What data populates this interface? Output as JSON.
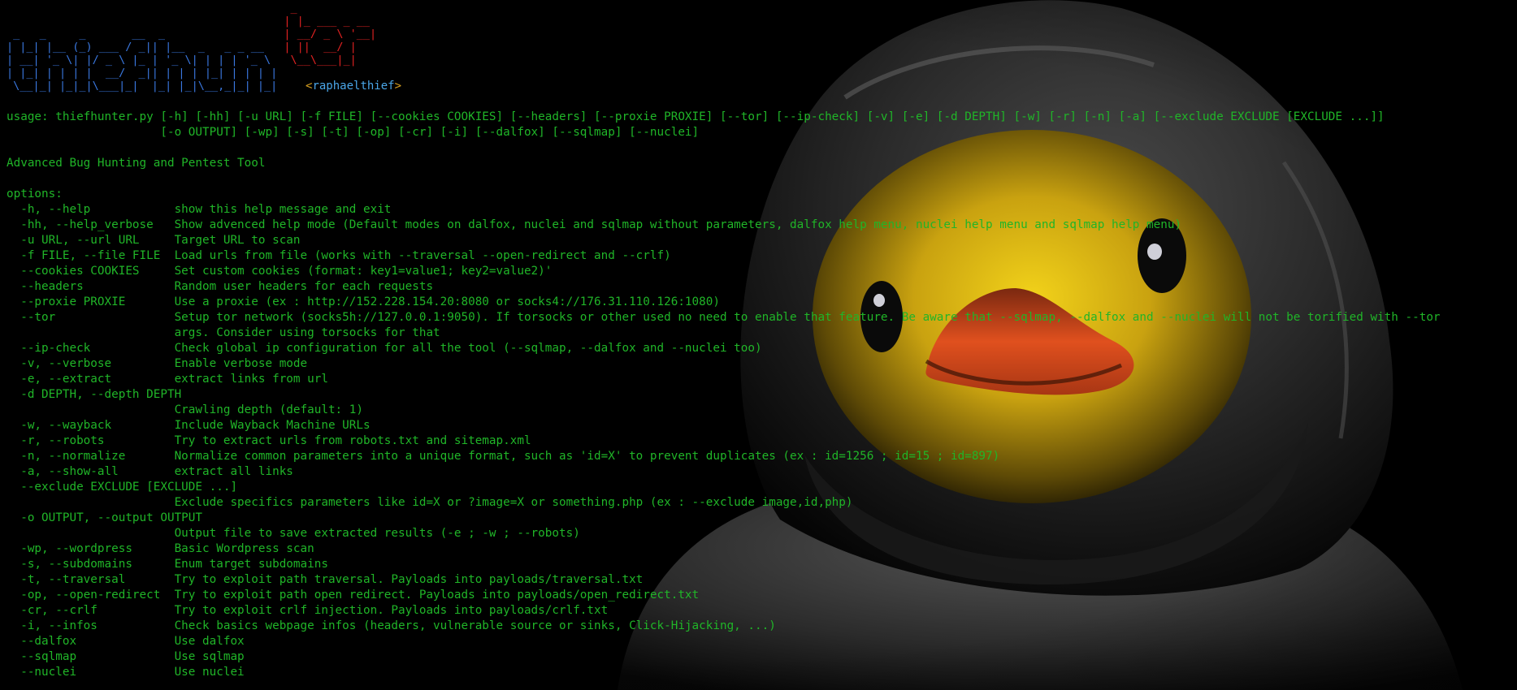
{
  "banner": {
    "ascii_blue": " _   _     _       __  _\n| |_| |__ (_) ___ / _|| |__  _   _ _ __\n| __| '_ \\| |/ _ \\ |_ | '_ \\| | | | '_ \\\n| |_| | | | |  __/  _|| | | | |_| | | | |\n \\__|_| |_|_|\\___|_|  |_| |_|\\__,_|_| |_|",
    "ascii_red": "                                           _\n                                          | |_ ___ _ __\n                                          | __/ _ \\ '__|\n                                          | ||  __/ |\n                                           \\__\\___|_|",
    "author_open": "<",
    "author_name": "raphaelthief",
    "author_close": ">"
  },
  "usage": [
    "usage: thiefhunter.py [-h] [-hh] [-u URL] [-f FILE] [--cookies COOKIES] [--headers] [--proxie PROXIE] [--tor] [--ip-check] [-v] [-e] [-d DEPTH] [-w] [-r] [-n] [-a] [--exclude EXCLUDE [EXCLUDE ...]]",
    "                      [-o OUTPUT] [-wp] [-s] [-t] [-op] [-cr] [-i] [--dalfox] [--sqlmap] [--nuclei]"
  ],
  "description": "Advanced Bug Hunting and Pentest Tool",
  "options_header": "options:",
  "options": [
    "  -h, --help            show this help message and exit",
    "  -hh, --help_verbose   Show advenced help mode (Default modes on dalfox, nuclei and sqlmap without parameters, dalfox help menu, nuclei help menu and sqlmap help menu)",
    "  -u URL, --url URL     Target URL to scan",
    "  -f FILE, --file FILE  Load urls from file (works with --traversal --open-redirect and --crlf)",
    "  --cookies COOKIES     Set custom cookies (format: key1=value1; key2=value2)'",
    "  --headers             Random user headers for each requests",
    "  --proxie PROXIE       Use a proxie (ex : http://152.228.154.20:8080 or socks4://176.31.110.126:1080)",
    "  --tor                 Setup tor network (socks5h://127.0.0.1:9050). If torsocks or other used no need to enable that feature. Be aware that --sqlmap, --dalfox and --nuclei will not be torified with --tor",
    "                        args. Consider using torsocks for that",
    "  --ip-check            Check global ip configuration for all the tool (--sqlmap, --dalfox and --nuclei too)",
    "  -v, --verbose         Enable verbose mode",
    "  -e, --extract         extract links from url",
    "  -d DEPTH, --depth DEPTH",
    "                        Crawling depth (default: 1)",
    "  -w, --wayback         Include Wayback Machine URLs",
    "  -r, --robots          Try to extract urls from robots.txt and sitemap.xml",
    "  -n, --normalize       Normalize common parameters into a unique format, such as 'id=X' to prevent duplicates (ex : id=1256 ; id=15 ; id=897)",
    "  -a, --show-all        extract all links",
    "  --exclude EXCLUDE [EXCLUDE ...]",
    "                        Exclude specifics parameters like id=X or ?image=X or something.php (ex : --exclude image,id,php)",
    "  -o OUTPUT, --output OUTPUT",
    "                        Output file to save extracted results (-e ; -w ; --robots)",
    "  -wp, --wordpress      Basic Wordpress scan",
    "  -s, --subdomains      Enum target subdomains",
    "  -t, --traversal       Try to exploit path traversal. Payloads into payloads/traversal.txt",
    "  -op, --open-redirect  Try to exploit path open redirect. Payloads into payloads/open_redirect.txt",
    "  -cr, --crlf           Try to exploit crlf injection. Payloads into payloads/crlf.txt",
    "  -i, --infos           Check basics webpage infos (headers, vulnerable source or sinks, Click-Hijacking, ...)",
    "  --dalfox              Use dalfox",
    "  --sqlmap              Use sqlmap",
    "  --nuclei              Use nuclei"
  ],
  "colors": {
    "terminal_text": "#20b528",
    "banner_blue": "#3a78e0",
    "banner_red": "#e32222",
    "author_name": "#4aa6e8",
    "author_bracket": "#d8a020",
    "background": "#000000"
  },
  "background_image": "hooded-duck-illustration"
}
